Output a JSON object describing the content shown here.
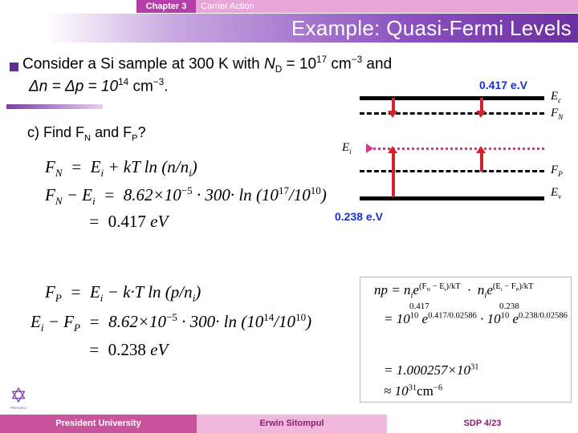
{
  "header": {
    "chapter": "Chapter 3",
    "subtitle": "Carrier Action",
    "title": "Example:  Quasi-Fermi Levels"
  },
  "body": {
    "line1_a": "Consider a Si sample at 300 K with ",
    "line1_ND": "N",
    "line1_ND_sub": "D",
    "line1_b": " = 10",
    "line1_exp1": "17",
    "line1_c": " cm",
    "line1_exp2": "−3",
    "line1_d": " and",
    "line2_a": "Δn = Δp = 10",
    "line2_exp1": "14",
    "line2_b": " cm",
    "line2_exp2": "−3",
    "line2_c": ".",
    "question": "c)  Find F",
    "question_sub1": "N",
    "question_mid": " and F",
    "question_sub2": "P",
    "question_end": "?"
  },
  "equations": {
    "a1": "Fₙ = Eᵢ + kT ln (n/nᵢ)",
    "a2": "Fₙ − Eᵢ = 8.62×10⁻⁵ · 300 · ln (10¹⁷/10¹⁰)",
    "a3": "= 0.417 eV",
    "b1": "Fₚ = Eᵢ − kT ln (p/nᵢ)",
    "b2": "Eᵢ − Fₚ = 8.62×10⁻⁵ · 300 · ln (10¹⁴/10¹⁰)",
    "b3": "= 0.238 eV"
  },
  "diagram": {
    "label_Ec": "E",
    "label_Ec_sub": "c",
    "label_FN": "F",
    "label_FN_sub": "N",
    "label_Ei": "E",
    "label_Ei_sub": "i",
    "label_FP": "F",
    "label_FP_sub": "P",
    "label_Ev": "E",
    "label_Ev_sub": "v",
    "value_top": "0.417 e.V",
    "value_bottom": "0.238 e.V",
    "value_color": "#1a2fd0"
  },
  "box": {
    "l1": "np = nᵢe^((Fₙ−Eᵢ)/kT) · nᵢe^((Eᵢ−Fₚ)/kT)",
    "exp_top_left": "0.417",
    "exp_top_right": "0.238",
    "l2": "= 10¹⁰ e^(0.417/0.02586) · 10¹⁰ e^(0.238/0.02586)",
    "l3": "= 1.000257×10³¹",
    "l4": "≈ 10³¹ cm⁻⁶"
  },
  "footer": {
    "left": "President University",
    "center": "Erwin Sitompul",
    "right": "SDP 4/23",
    "logo_glyph": "✡",
    "logo_caption": "PRESUNIV"
  }
}
